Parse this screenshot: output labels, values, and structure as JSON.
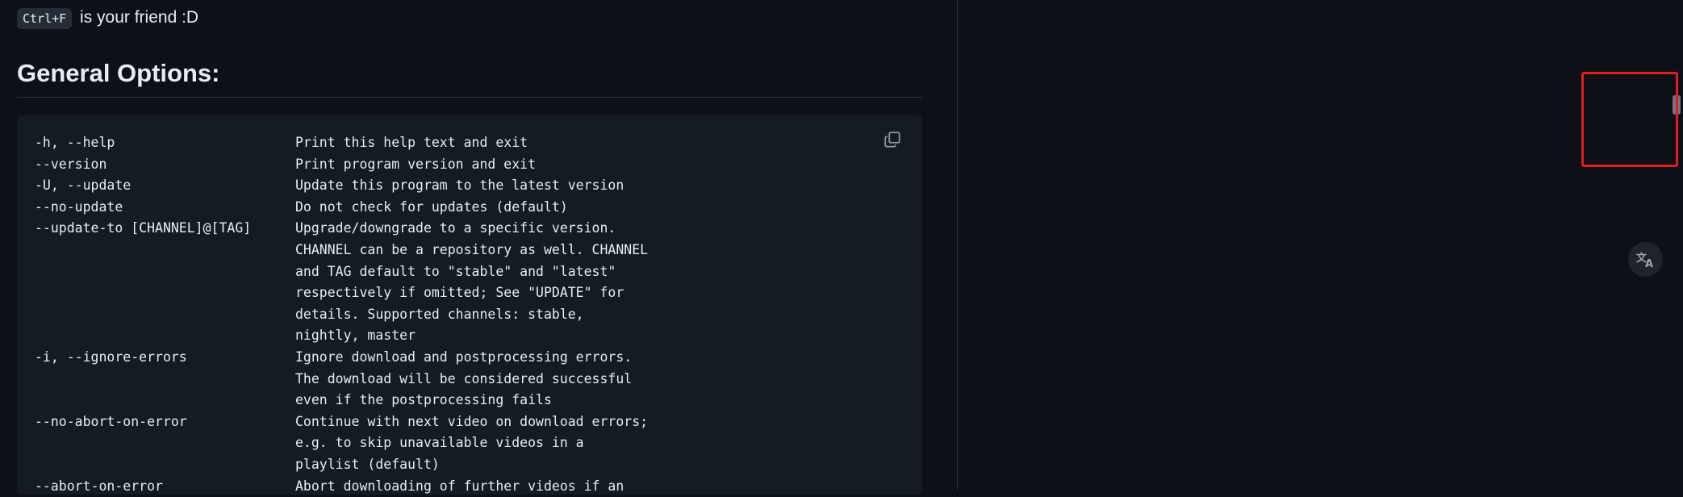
{
  "readme": {
    "intro": {
      "kbd": "Ctrl+F",
      "text": "is your friend :D"
    },
    "heading": "General Options:",
    "options": [
      {
        "opt": "-h, --help",
        "desc": "Print this help text and exit"
      },
      {
        "opt": "--version",
        "desc": "Print program version and exit"
      },
      {
        "opt": "-U, --update",
        "desc": "Update this program to the latest version"
      },
      {
        "opt": "--no-update",
        "desc": "Do not check for updates (default)"
      },
      {
        "opt": "--update-to [CHANNEL]@[TAG]",
        "desc": "Upgrade/downgrade to a specific version."
      },
      {
        "opt": "",
        "desc": "CHANNEL can be a repository as well. CHANNEL"
      },
      {
        "opt": "",
        "desc": "and TAG default to \"stable\" and \"latest\""
      },
      {
        "opt": "",
        "desc": "respectively if omitted; See \"UPDATE\" for"
      },
      {
        "opt": "",
        "desc": "details. Supported channels: stable,"
      },
      {
        "opt": "",
        "desc": "nightly, master"
      },
      {
        "opt": "-i, --ignore-errors",
        "desc": "Ignore download and postprocessing errors."
      },
      {
        "opt": "",
        "desc": "The download will be considered successful"
      },
      {
        "opt": "",
        "desc": "even if the postprocessing fails"
      },
      {
        "opt": "--no-abort-on-error",
        "desc": "Continue with next video on download errors;"
      },
      {
        "opt": "",
        "desc": "e.g. to skip unavailable videos in a"
      },
      {
        "opt": "",
        "desc": "playlist (default)"
      },
      {
        "opt": "--abort-on-error",
        "desc": "Abort downloading of further videos if an"
      }
    ]
  },
  "icons": {
    "copy": "copy-icon",
    "translate": "translate-icon"
  },
  "colors": {
    "background": "#0d1117",
    "code_background": "#151b23",
    "highlight_border": "#e11d1d"
  }
}
